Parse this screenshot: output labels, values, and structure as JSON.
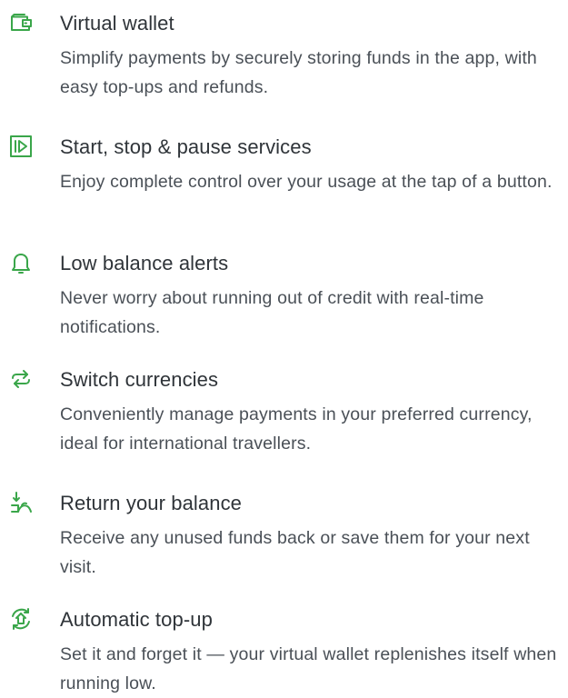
{
  "accent_color": "#3aa64a",
  "features": [
    {
      "icon": "wallet-icon",
      "title": "Virtual wallet",
      "description": "Simplify payments by securely storing funds in the app, with easy top-ups and refunds."
    },
    {
      "icon": "play-pause-icon",
      "title": "Start, stop & pause services",
      "description": "Enjoy complete control over your usage at the tap of a button."
    },
    {
      "icon": "bell-icon",
      "title": "Low balance alerts",
      "description": "Never worry about running out of credit with real-time notifications."
    },
    {
      "icon": "switch-arrows-icon",
      "title": "Switch currencies",
      "description": "Conveniently manage payments in your preferred currency, ideal for international travellers."
    },
    {
      "icon": "return-funds-icon",
      "title": "Return your balance",
      "description": "Receive any unused funds back or save them for your next visit."
    },
    {
      "icon": "auto-topup-icon",
      "title": "Automatic top-up",
      "description": "Set it and forget it — your virtual wallet replenishes itself when running low."
    }
  ]
}
